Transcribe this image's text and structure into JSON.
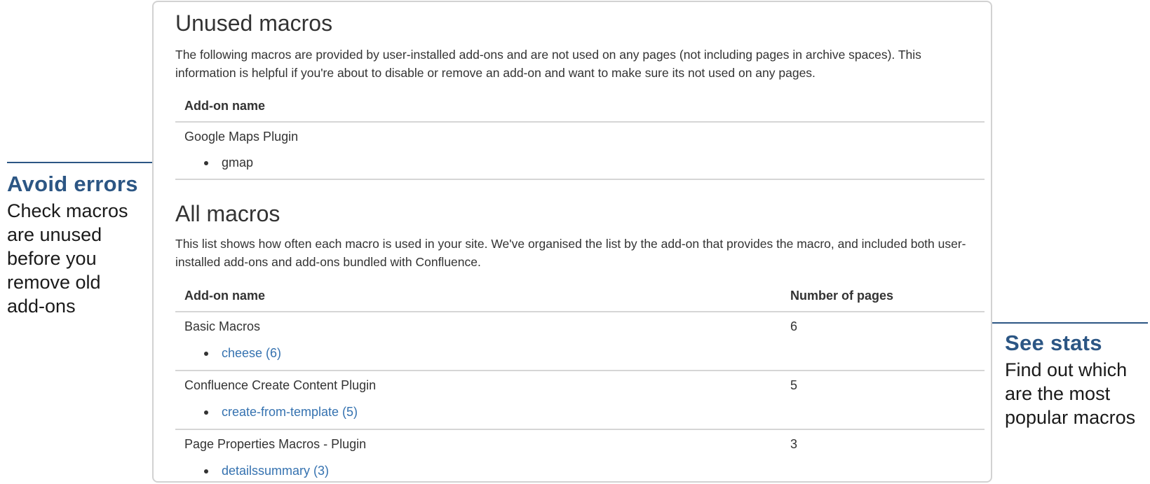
{
  "unused": {
    "title": "Unused macros",
    "description": "The following macros are provided by user-installed add-ons and are not used on any pages (not including pages in archive spaces). This information is helpful if you're about to disable or remove an add-on and want to make sure its not used on any pages.",
    "column_header": "Add-on name",
    "addons": [
      {
        "name": "Google Maps Plugin",
        "macros": [
          "gmap"
        ]
      }
    ]
  },
  "all": {
    "title": "All macros",
    "description": "This list shows how often each macro is used in your site. We've organised the list by the add-on that provides the macro, and included both user-installed add-ons and add-ons bundled with Confluence.",
    "column_headers": [
      "Add-on name",
      "Number of pages"
    ],
    "rows": [
      {
        "addon": "Basic Macros",
        "pages": "6",
        "macro": "cheese (6)"
      },
      {
        "addon": "Confluence Create Content Plugin",
        "pages": "5",
        "macro": "create-from-template (5)"
      },
      {
        "addon": "Page Properties Macros - Plugin",
        "pages": "3",
        "macro": "detailssummary (3)"
      }
    ]
  },
  "callouts": {
    "left": {
      "title": "Avoid errors",
      "body": "Check macros\nare unused\nbefore you\nremove old\nadd-ons"
    },
    "right": {
      "title": "See stats",
      "body": "Find out which\nare the most\npopular macros"
    }
  },
  "colors": {
    "link": "#3572b0",
    "callout_accent": "#2c5684",
    "rule": "#d6d6d6",
    "panel_border": "#d2d2d2"
  }
}
